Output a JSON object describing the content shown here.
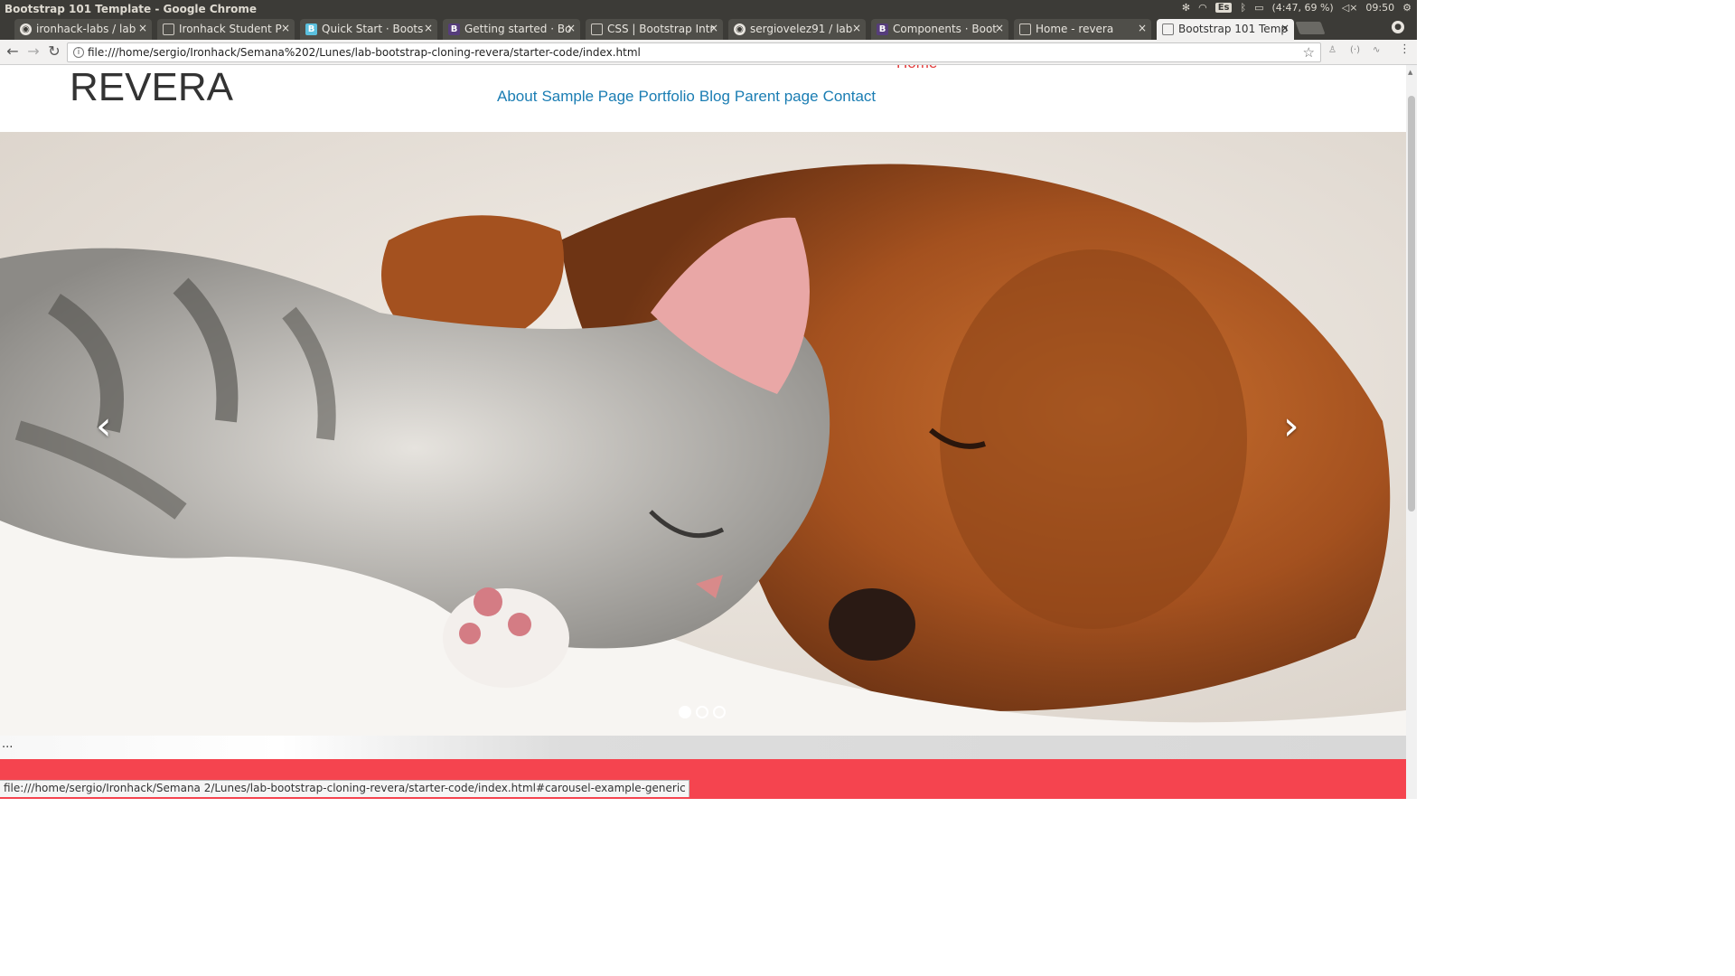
{
  "os_bar": {
    "window_title": "Bootstrap 101 Template - Google Chrome",
    "keyboard": "Es",
    "battery": "(4:47, 69 %)",
    "clock": "09:50"
  },
  "tabs": [
    {
      "label": "ironhack-labs / lab",
      "icon": "github-icon"
    },
    {
      "label": "Ironhack Student P",
      "icon": "page-icon"
    },
    {
      "label": "Quick Start · Boots",
      "icon": "bootstrap-icon"
    },
    {
      "label": "Getting started · Bo",
      "icon": "bootstrap-icon"
    },
    {
      "label": "CSS | Bootstrap Intr",
      "icon": "page-icon"
    },
    {
      "label": "sergiovelez91 / lab",
      "icon": "github-icon"
    },
    {
      "label": "Components · Boot",
      "icon": "bootstrap-icon"
    },
    {
      "label": "Home - revera",
      "icon": "page-icon"
    },
    {
      "label": "Bootstrap 101 Temp",
      "icon": "page-icon",
      "active": true
    }
  ],
  "toolbar": {
    "url": "file:///home/sergio/Ironhack/Semana%202/Lunes/lab-bootstrap-cloning-revera/starter-code/index.html"
  },
  "page": {
    "brand": "REVERA",
    "home_link": "Home",
    "nav_links": [
      "About",
      "Sample Page",
      "Portfolio",
      "Blog",
      "Parent page",
      "Contact"
    ],
    "carousel": {
      "prev_glyph": "‹",
      "next_glyph": "›",
      "slide_count": 3,
      "active_slide": 1,
      "caption_hint": "~~~"
    },
    "ellipsis": "..."
  },
  "status_bar": {
    "text": "file:///home/sergio/Ironhack/Semana 2/Lunes/lab-bootstrap-cloning-revera/starter-code/index.html#carousel-example-generic"
  },
  "colors": {
    "brand_text": "#333333",
    "nav_link": "#1a7db3",
    "home_link": "#e23a3a",
    "red_band": "#f5444f"
  }
}
